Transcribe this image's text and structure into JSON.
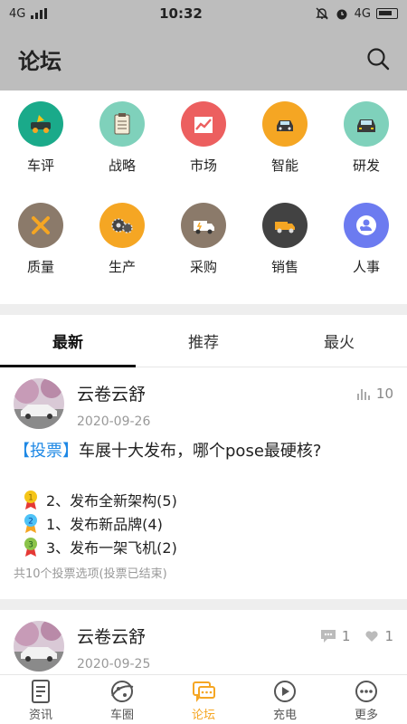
{
  "status": {
    "network_left": "4G",
    "time": "10:32",
    "network_right": "4G"
  },
  "header": {
    "title": "论坛"
  },
  "categories": [
    {
      "label": "车评",
      "color": "#1aaa8a",
      "icon": "car-review-icon"
    },
    {
      "label": "战略",
      "color": "#7fd1bb",
      "icon": "clipboard-icon"
    },
    {
      "label": "市场",
      "color": "#ec5f5f",
      "icon": "trend-chart-icon"
    },
    {
      "label": "智能",
      "color": "#f5a623",
      "icon": "smart-car-icon"
    },
    {
      "label": "研发",
      "color": "#7fd1bb",
      "icon": "car-front-icon"
    },
    {
      "label": "质量",
      "color": "#8b7a6a",
      "icon": "tools-icon"
    },
    {
      "label": "生产",
      "color": "#f5a623",
      "icon": "gears-icon"
    },
    {
      "label": "采购",
      "color": "#8b7a6a",
      "icon": "truck-icon"
    },
    {
      "label": "销售",
      "color": "#424242",
      "icon": "delivery-truck-icon"
    },
    {
      "label": "人事",
      "color": "#6c7bf0",
      "icon": "people-icon"
    }
  ],
  "tabs": [
    {
      "label": "最新"
    },
    {
      "label": "推荐"
    },
    {
      "label": "最火"
    }
  ],
  "posts": [
    {
      "author": "云卷云舒",
      "date": "2020-09-26",
      "views": "10",
      "tag": "【投票】",
      "title": "车展十大发布，哪个pose最硬核?",
      "options": [
        {
          "medal": "1",
          "text": "2、发布全新架构(5)",
          "color": "#f5c518"
        },
        {
          "medal": "2",
          "text": "1、发布新品牌(4)",
          "color": "#4fc3f7"
        },
        {
          "medal": "3",
          "text": "3、发布一架飞机(2)",
          "color": "#8bc34a"
        }
      ],
      "summary": "共10个投票选项(投票已结束)"
    },
    {
      "author": "云卷云舒",
      "date": "2020-09-25",
      "comments": "1",
      "likes": "1"
    }
  ],
  "bottom_nav": [
    {
      "label": "资讯",
      "icon": "news-icon"
    },
    {
      "label": "车圈",
      "icon": "planet-icon"
    },
    {
      "label": "论坛",
      "icon": "chat-icon",
      "active": true
    },
    {
      "label": "充电",
      "icon": "play-icon"
    },
    {
      "label": "更多",
      "icon": "more-icon"
    }
  ]
}
